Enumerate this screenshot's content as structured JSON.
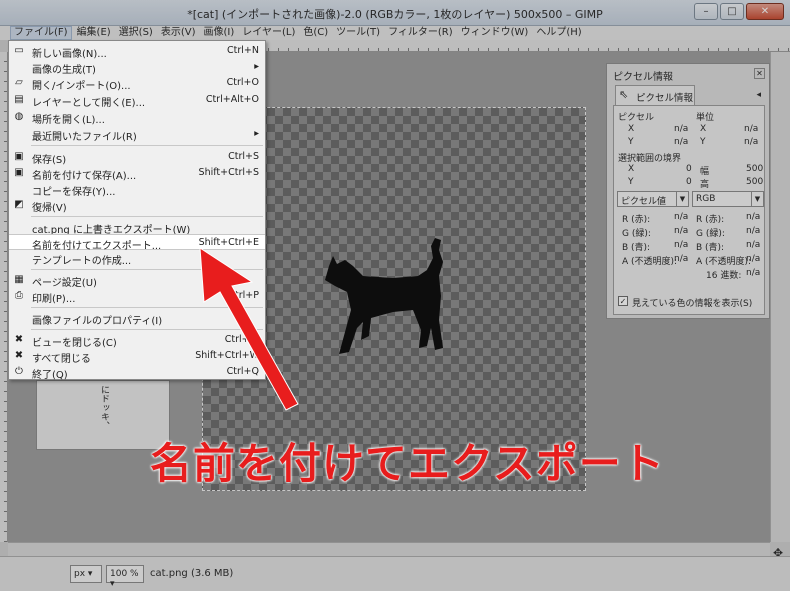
{
  "window": {
    "title": "*[cat] (インポートされた画像)-2.0 (RGBカラー, 1枚のレイヤー) 500x500 – GIMP",
    "minimize": "–",
    "maximize": "□",
    "close": "✕"
  },
  "menubar": [
    "ファイル(F)",
    "編集(E)",
    "選択(S)",
    "表示(V)",
    "画像(I)",
    "レイヤー(L)",
    "色(C)",
    "ツール(T)",
    "フィルター(R)",
    "ウィンドウ(W)",
    "ヘルプ(H)"
  ],
  "file_menu": {
    "items": [
      {
        "label": "新しい画像(N)...",
        "shortcut": "Ctrl+N",
        "icon": "new-document-icon"
      },
      {
        "label": "画像の生成(T)",
        "shortcut": "▸",
        "icon": ""
      },
      {
        "label": "開く/インポート(O)...",
        "shortcut": "Ctrl+O",
        "icon": "open-folder-icon"
      },
      {
        "label": "レイヤーとして開く(E)...",
        "shortcut": "Ctrl+Alt+O",
        "icon": "open-layer-icon"
      },
      {
        "label": "場所を開く(L)...",
        "shortcut": "",
        "icon": "globe-icon"
      },
      {
        "label": "最近開いたファイル(R)",
        "shortcut": "▸",
        "icon": ""
      },
      {
        "label": "保存(S)",
        "shortcut": "Ctrl+S",
        "icon": "save-icon"
      },
      {
        "label": "名前を付けて保存(A)...",
        "shortcut": "Shift+Ctrl+S",
        "icon": "save-as-icon"
      },
      {
        "label": "コピーを保存(Y)...",
        "shortcut": "",
        "icon": ""
      },
      {
        "label": "復帰(V)",
        "shortcut": "",
        "icon": "revert-icon"
      },
      {
        "label": "cat.png に上書きエクスポート(W)",
        "shortcut": "",
        "icon": ""
      },
      {
        "label": "名前を付けてエクスポート...",
        "shortcut": "Shift+Ctrl+E",
        "icon": ""
      },
      {
        "label": "テンプレートの作成...",
        "shortcut": "",
        "icon": ""
      },
      {
        "label": "ページ設定(U)",
        "shortcut": "",
        "icon": "page-setup-icon"
      },
      {
        "label": "印刷(P)...",
        "shortcut": "Ctrl+P",
        "icon": "print-icon"
      },
      {
        "label": "画像ファイルのプロパティ(I)",
        "shortcut": "",
        "icon": ""
      },
      {
        "label": "ビューを閉じる(C)",
        "shortcut": "Ctrl+W",
        "icon": "close-x-icon"
      },
      {
        "label": "すべて閉じる",
        "shortcut": "Shift+Ctrl+W",
        "icon": "close-all-icon"
      },
      {
        "label": "終了(Q)",
        "shortcut": "Ctrl+Q",
        "icon": "quit-icon"
      }
    ]
  },
  "pixel_panel": {
    "title": "ピクセル情報",
    "tab": "ピクセル情報",
    "pixel_header": "ピクセル",
    "unit_header": "単位",
    "x": "X",
    "y": "Y",
    "na": "n/a",
    "selection_header": "選択範囲の境界",
    "sel_x": "0",
    "sel_y": "0",
    "width_label": "幅",
    "height_label": "高",
    "width_val": "500",
    "height_val": "500",
    "combo_left": "ピクセル値",
    "combo_right": "RGB",
    "left_rows": [
      "R (赤):",
      "G (緑):",
      "B (青):",
      "A (不透明度):"
    ],
    "right_rows": [
      "R (赤):",
      "G (緑):",
      "B (青):",
      "A (不透明度):",
      "16 進数:"
    ],
    "checkbox_label": "見えている色の情報を表示(S)",
    "checked": true
  },
  "left_panel_vertical_text": "にドッキ、",
  "statusbar": {
    "unit": "px",
    "zoom": "100 %",
    "file": "cat.png (3.6 MB)"
  },
  "annotation": "名前を付けてエクスポート",
  "colors": {
    "annotation_red": "#e81d1d",
    "highlight_row": "#ffffff"
  }
}
